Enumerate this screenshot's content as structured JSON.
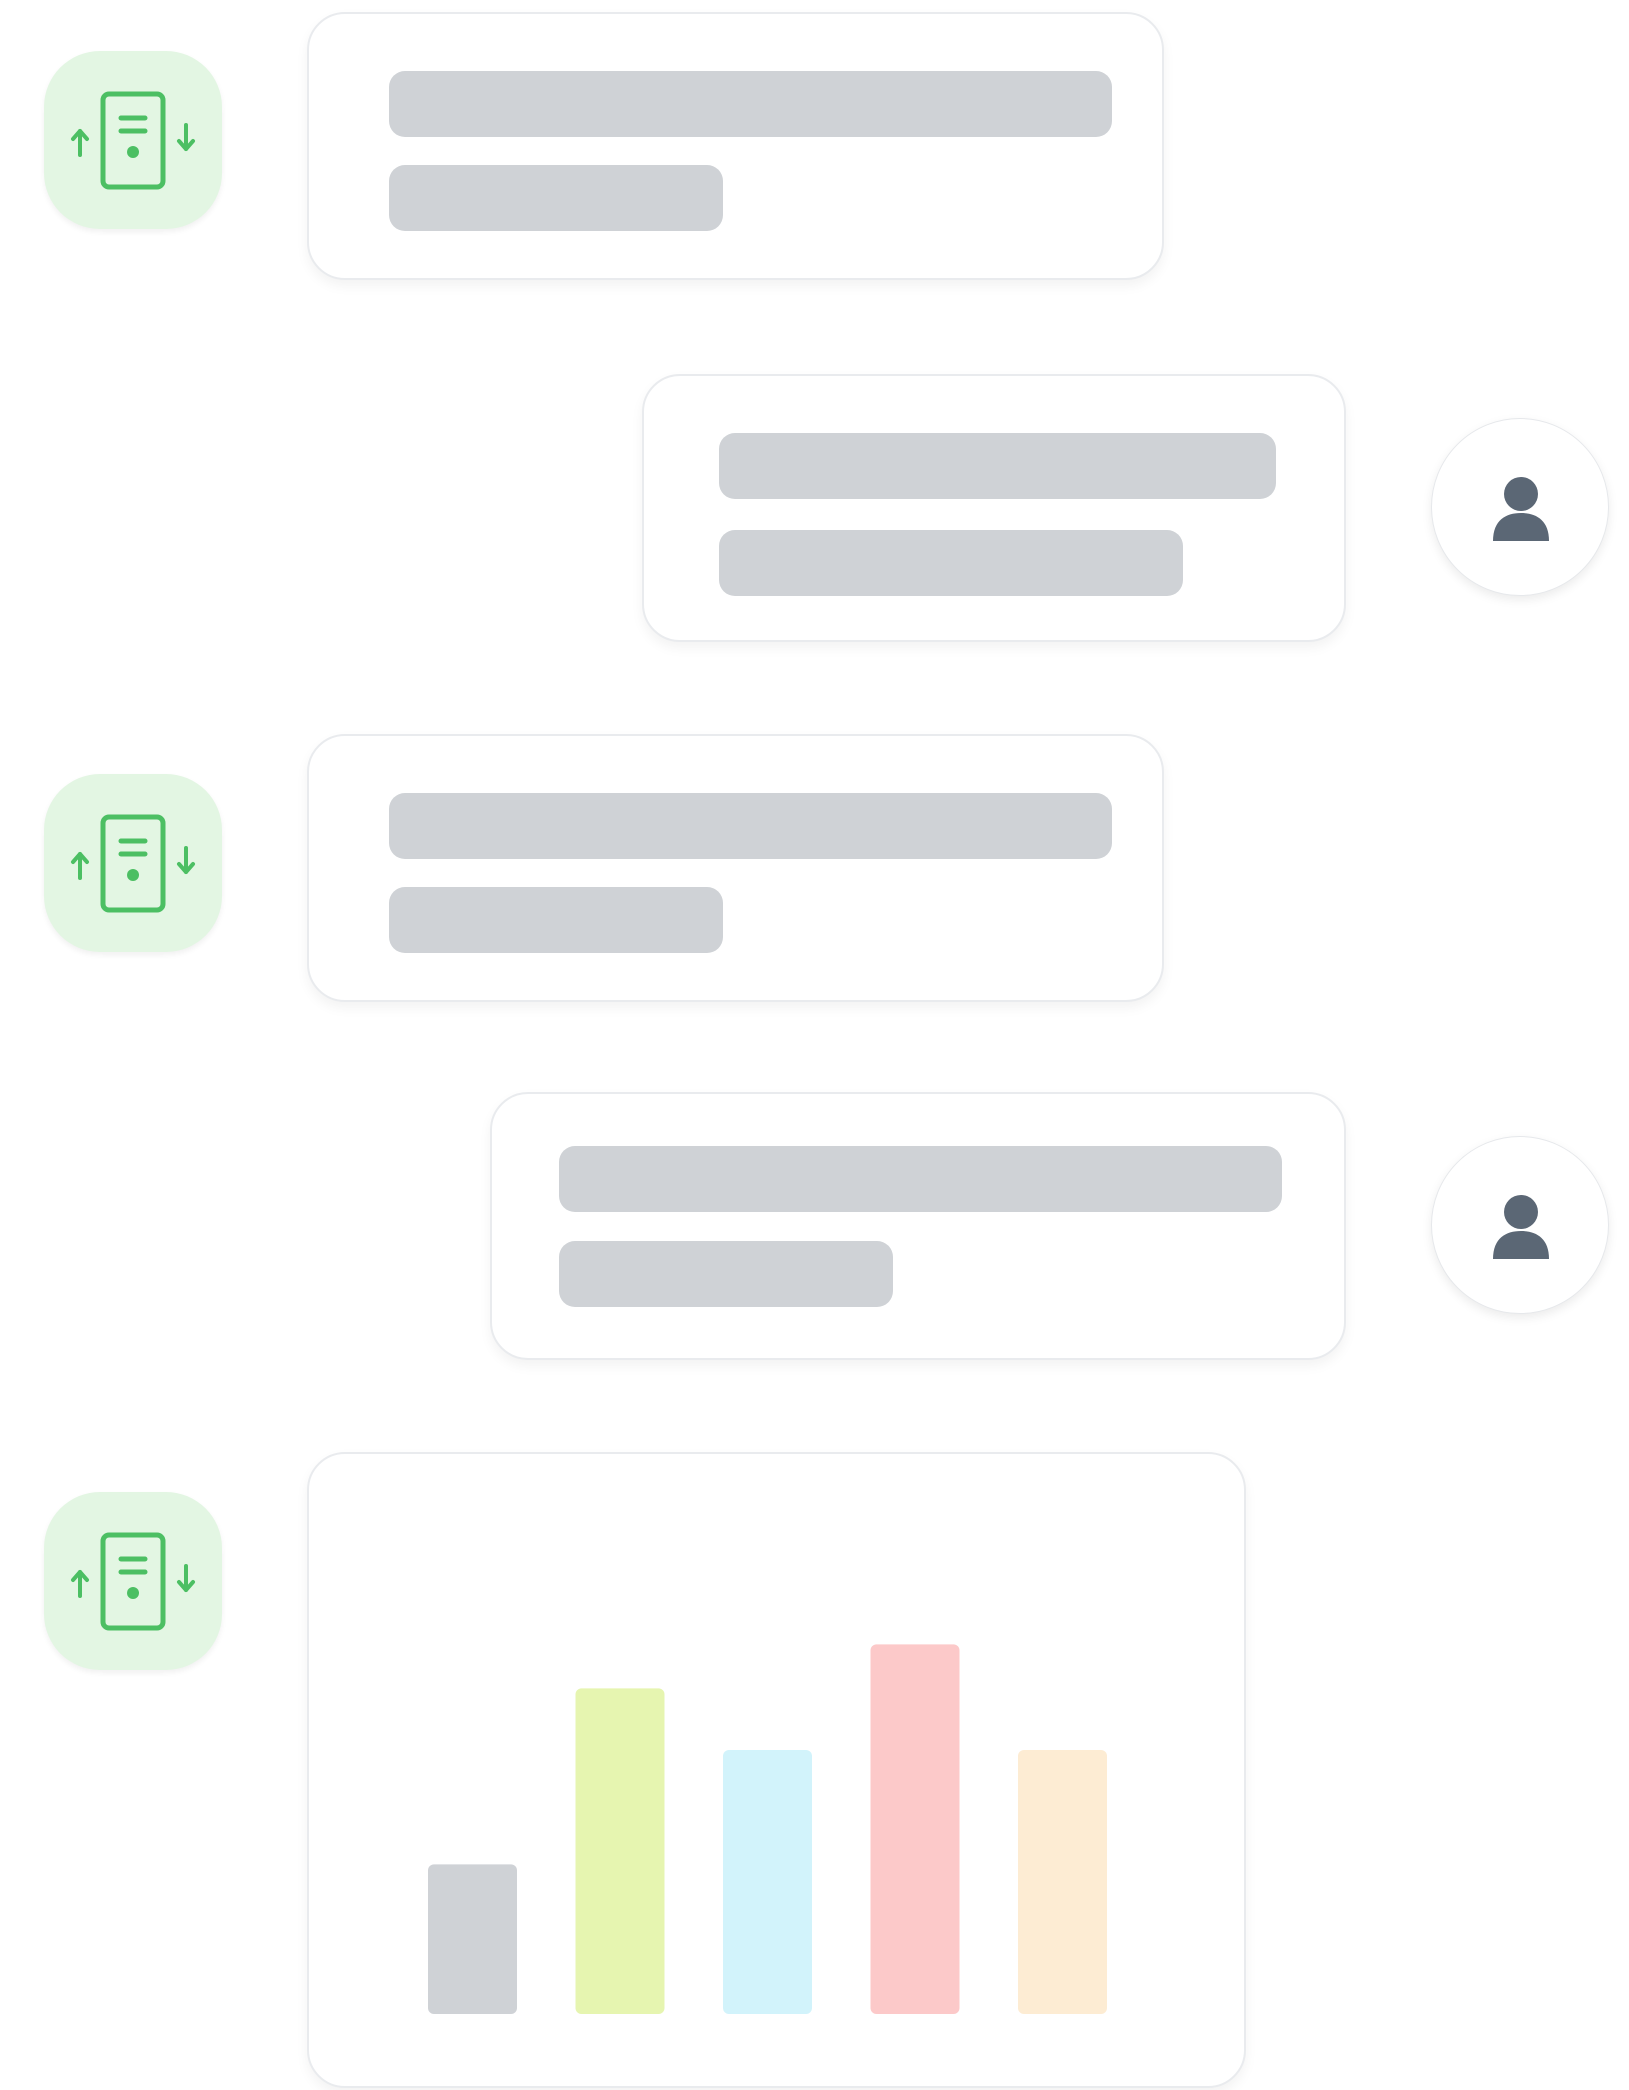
{
  "colors": {
    "bot_avatar_bg": "#e3f6e3",
    "bot_icon_stroke": "#4cbf63",
    "user_icon_fill": "#5b6775",
    "skeleton": "#cfd2d6",
    "bubble_border": "#e9ebee"
  },
  "icons": {
    "bot": "device-sync-icon",
    "user": "person-icon"
  },
  "messages": [
    {
      "role": "bot",
      "type": "text-placeholder"
    },
    {
      "role": "user",
      "type": "text-placeholder"
    },
    {
      "role": "bot",
      "type": "text-placeholder"
    },
    {
      "role": "user",
      "type": "text-placeholder"
    },
    {
      "role": "bot",
      "type": "chart"
    }
  ],
  "chart_data": {
    "type": "bar",
    "categories": [
      "",
      "",
      "",
      "",
      ""
    ],
    "values": [
      34,
      74,
      60,
      84,
      60
    ],
    "ylim": [
      0,
      100
    ],
    "colors": [
      "#cfd2d6",
      "#e6f5b0",
      "#d2f3fb",
      "#fcc9c9",
      "#fdecd3"
    ],
    "grid": false,
    "axes_visible": false
  }
}
